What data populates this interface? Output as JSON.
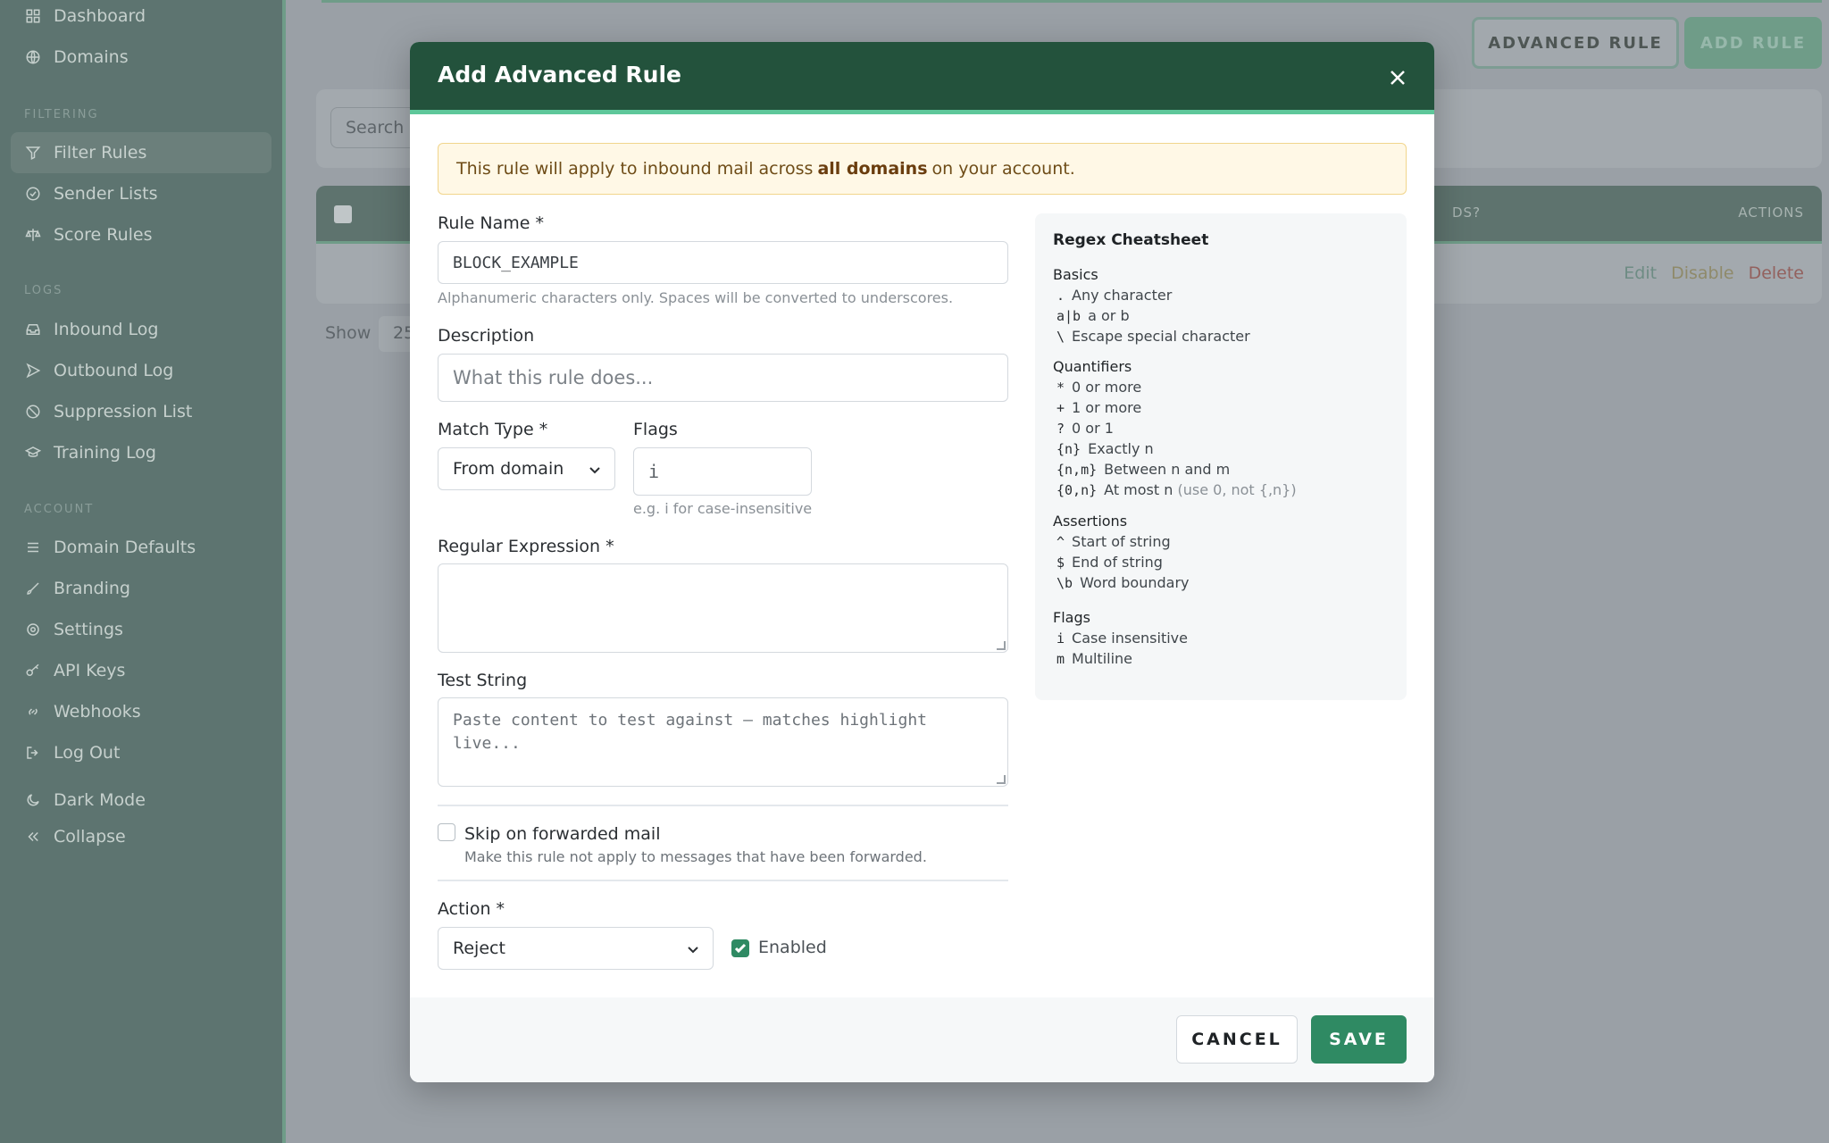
{
  "sidebar": {
    "items_top": [
      {
        "label": "Dashboard",
        "icon": "grid-icon"
      },
      {
        "label": "Domains",
        "icon": "globe-icon"
      }
    ],
    "section_filtering": "FILTERING",
    "items_filtering": [
      {
        "label": "Filter Rules",
        "icon": "filter-icon",
        "active": true
      },
      {
        "label": "Sender Lists",
        "icon": "check-circle-icon"
      },
      {
        "label": "Score Rules",
        "icon": "scale-icon"
      }
    ],
    "section_logs": "LOGS",
    "items_logs": [
      {
        "label": "Inbound Log",
        "icon": "inbox-icon"
      },
      {
        "label": "Outbound Log",
        "icon": "send-icon"
      },
      {
        "label": "Suppression List",
        "icon": "ban-icon"
      },
      {
        "label": "Training Log",
        "icon": "graduation-icon"
      }
    ],
    "section_account": "ACCOUNT",
    "items_account": [
      {
        "label": "Domain Defaults",
        "icon": "sliders-icon"
      },
      {
        "label": "Branding",
        "icon": "brush-icon"
      },
      {
        "label": "Settings",
        "icon": "gear-icon"
      },
      {
        "label": "API Keys",
        "icon": "key-icon"
      },
      {
        "label": "Webhooks",
        "icon": "link-icon"
      },
      {
        "label": "Log Out",
        "icon": "logout-icon"
      }
    ],
    "dark_mode": "Dark Mode",
    "collapse": "Collapse"
  },
  "background": {
    "advanced_rule_button": "ADVANCED RULE",
    "add_rule_button": "ADD RULE",
    "search_placeholder": "Search",
    "col_ds": "DS?",
    "col_actions": "ACTIONS",
    "row_edit": "Edit",
    "row_disable": "Disable",
    "row_delete": "Delete",
    "show_label": "Show",
    "show_value": "25"
  },
  "modal": {
    "title": "Add Advanced Rule",
    "notice_pre": "This rule will apply to inbound mail across",
    "notice_bold": "all domains",
    "notice_post": "on your account.",
    "rule_name_label": "Rule Name *",
    "rule_name_value": "BLOCK_EXAMPLE",
    "rule_name_hint": "Alphanumeric characters only. Spaces will be converted to underscores.",
    "description_label": "Description",
    "description_placeholder": "What this rule does...",
    "match_type_label": "Match Type *",
    "match_type_value": "From domain",
    "flags_label": "Flags",
    "flags_value": "i",
    "flags_hint": "e.g. i for case-insensitive",
    "regex_label": "Regular Expression *",
    "test_string_label": "Test String",
    "test_string_placeholder": "Paste content to test against — matches highlight live...",
    "skip_label": "Skip on forwarded mail",
    "skip_hint": "Make this rule not apply to messages that have been forwarded.",
    "skip_checked": false,
    "action_label": "Action *",
    "action_value": "Reject",
    "enabled_label": "Enabled",
    "enabled_checked": true,
    "cancel_label": "CANCEL",
    "save_label": "SAVE"
  },
  "cheatsheet": {
    "title": "Regex Cheatsheet",
    "basics_title": "Basics",
    "basics": [
      {
        "code": ".",
        "text": "Any character"
      },
      {
        "code": "a|b",
        "text": "a or b"
      },
      {
        "code": "\\",
        "text": "Escape special character"
      }
    ],
    "quantifiers_title": "Quantifiers",
    "quantifiers": [
      {
        "code": "*",
        "text": "0 or more"
      },
      {
        "code": "+",
        "text": "1 or more"
      },
      {
        "code": "?",
        "text": "0 or 1"
      },
      {
        "code": "{n}",
        "text": "Exactly n"
      },
      {
        "code": "{n,m}",
        "text": "Between n and m"
      },
      {
        "code": "{0,n}",
        "text": "At most n",
        "note": "(use 0, not {,n})"
      }
    ],
    "assertions_title": "Assertions",
    "assertions": [
      {
        "code": "^",
        "text": "Start of string"
      },
      {
        "code": "$",
        "text": "End of string"
      },
      {
        "code": "\\b",
        "text": "Word boundary"
      }
    ],
    "flags_title": "Flags",
    "flags": [
      {
        "code": "i",
        "text": "Case insensitive"
      },
      {
        "code": "m",
        "text": "Multiline"
      }
    ]
  },
  "colors": {
    "header_green": "#23523c",
    "accent_green": "#2f8a63",
    "notice_bg": "#fff8e6"
  }
}
